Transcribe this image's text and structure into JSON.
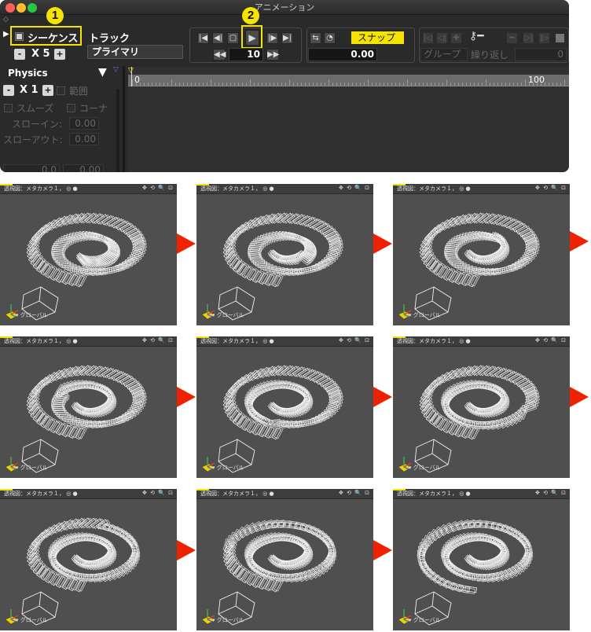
{
  "window": {
    "title": "アニメーション"
  },
  "left_panel": {
    "sequence_label": "シーケンス",
    "sequence_checked": true,
    "track_label": "トラック",
    "multiplier": "X 5",
    "track_value": "プライマリ",
    "physics_label": "Physics",
    "physics_multiplier": "X 1",
    "range_label": "範囲",
    "smooth_label": "スムーズ",
    "corner_label": "コーナ",
    "slow_in_label": "スローイン:",
    "slow_in_value": "0.00",
    "slow_out_label": "スローアウト:",
    "slow_out_value": "0.00",
    "bottom_value_1": "0.0",
    "bottom_value_2": "0.00"
  },
  "transport": {
    "frame_value": "10"
  },
  "snap": {
    "label": "スナップ",
    "value": "0.00"
  },
  "keys": {
    "group_label": "グループ",
    "repeat_label": "繰り返し",
    "value": "0"
  },
  "timeline": {
    "start_label": "0",
    "end_label": "100"
  },
  "callouts": [
    "1",
    "2"
  ],
  "viewport": {
    "title": "透視図：メタカメラ１，",
    "footer": "グローバル",
    "icons": "✥ ⟲ 🔍 ⊡"
  },
  "frames": [
    {
      "label": "frame-1"
    },
    {
      "label": "frame-2"
    },
    {
      "label": "frame-3"
    },
    {
      "label": "frame-4"
    },
    {
      "label": "frame-5"
    },
    {
      "label": "frame-6"
    },
    {
      "label": "frame-7"
    },
    {
      "label": "frame-8"
    },
    {
      "label": "frame-9"
    }
  ],
  "colors": {
    "highlight": "#f5e400",
    "arrow": "#ee2200",
    "viewport_bg": "#4f4f4f"
  }
}
